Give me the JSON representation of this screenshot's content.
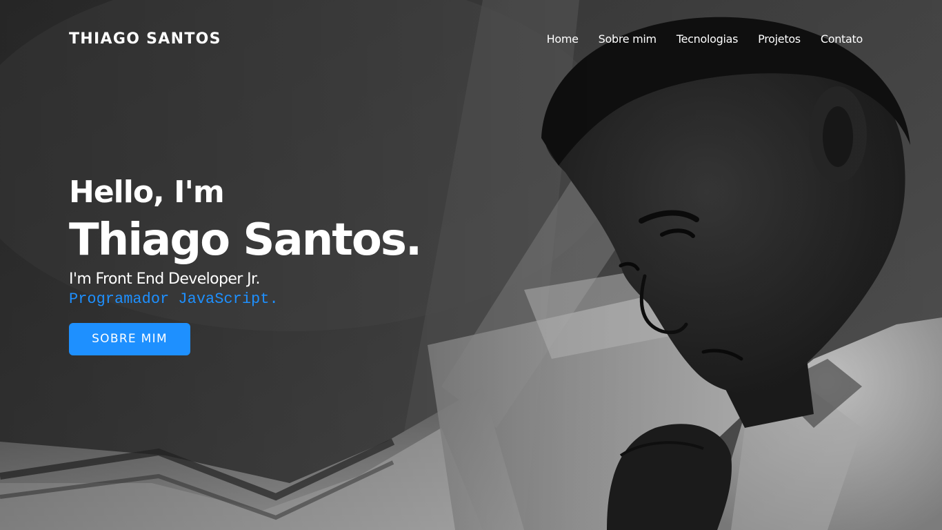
{
  "brand": {
    "name": "THIAGO SANTOS"
  },
  "nav": {
    "items": [
      {
        "label": "Home"
      },
      {
        "label": "Sobre mim"
      },
      {
        "label": "Tecnologias"
      },
      {
        "label": "Projetos"
      },
      {
        "label": "Contato"
      }
    ]
  },
  "hero": {
    "greeting": "Hello, I'm",
    "name": "Thiago Santos.",
    "role": "I'm Front End Developer Jr.",
    "typed_text": "Programador JavaScript.",
    "cta_label": "SOBRE MIM",
    "background_photo": "grayscale-portrait-of-young-man-reading"
  },
  "colors": {
    "accent": "#1e90ff",
    "text": "#ffffff",
    "overlay": "#000000"
  }
}
